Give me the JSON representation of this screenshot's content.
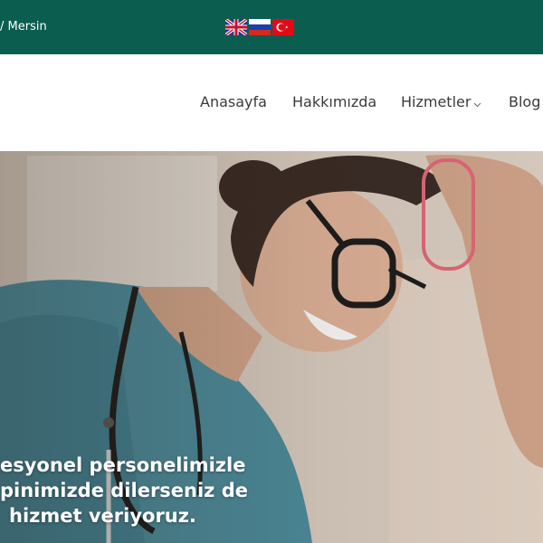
{
  "topbar": {
    "location_text": "/ Mersin",
    "languages": [
      {
        "name": "English",
        "icon": "uk-flag-icon"
      },
      {
        "name": "Russian",
        "icon": "russia-flag-icon"
      },
      {
        "name": "Turkish",
        "icon": "turkey-flag-icon"
      }
    ],
    "background_color": "#0b5e4f"
  },
  "nav": {
    "items": [
      {
        "label": "Anasayfa"
      },
      {
        "label": "Hakkımızda"
      },
      {
        "label": "Hizmetler",
        "has_dropdown": true
      },
      {
        "label": "Blog"
      }
    ]
  },
  "hero": {
    "lines": [
      "esyonel personelimizle",
      "pinimizde dilerseniz de",
      "hizmet veriyoruz."
    ],
    "image": "smiling-nurse-with-stethoscope"
  }
}
